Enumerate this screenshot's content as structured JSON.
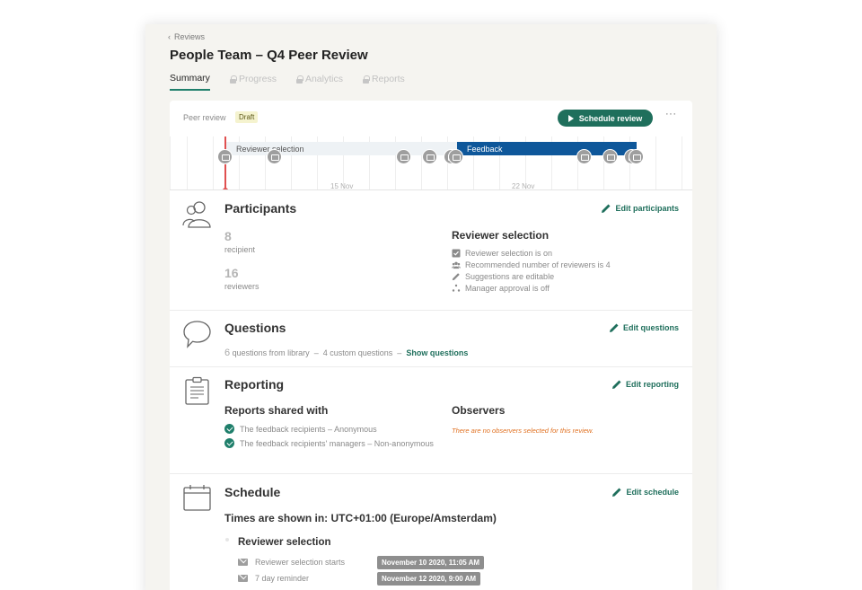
{
  "breadcrumb": {
    "label": "Reviews"
  },
  "page": {
    "title": "People Team – Q4 Peer Review"
  },
  "tabs": [
    {
      "label": "Summary",
      "active": true,
      "locked": false
    },
    {
      "label": "Progress",
      "active": false,
      "locked": true
    },
    {
      "label": "Analytics",
      "active": false,
      "locked": true
    },
    {
      "label": "Reports",
      "active": false,
      "locked": true
    }
  ],
  "header": {
    "type_label": "Peer review",
    "status_badge": "Draft",
    "schedule_button": "Schedule review",
    "more_label": "···"
  },
  "timeline": {
    "phases": [
      {
        "label": "Reviewer selection",
        "color": "#eef2f5"
      },
      {
        "label": "Feedback",
        "color": "#0e579a"
      }
    ],
    "tick_labels": [
      "15 Nov",
      "22 Nov"
    ],
    "today_color": "#e05050"
  },
  "participants": {
    "title": "Participants",
    "edit_label": "Edit participants",
    "recipients_count": "8",
    "recipients_label": "recipient",
    "reviewers_count": "16",
    "reviewers_label": "reviewers",
    "reviewer_selection": {
      "title": "Reviewer selection",
      "items": [
        {
          "icon": "checkbox-icon",
          "label": "Reviewer selection is on"
        },
        {
          "icon": "people-icon",
          "label": "Recommended number of reviewers is 4"
        },
        {
          "icon": "pencil-icon",
          "label": "Suggestions are editable"
        },
        {
          "icon": "dots-icon",
          "label": "Manager approval is off"
        }
      ]
    }
  },
  "questions": {
    "title": "Questions",
    "edit_label": "Edit questions",
    "library_count": "6",
    "library_label": "questions from library",
    "sep1": "–",
    "custom_label": "4 custom questions",
    "sep2": "–",
    "show_label": "Show questions"
  },
  "reporting": {
    "title": "Reporting",
    "edit_label": "Edit reporting",
    "shared_title": "Reports shared with",
    "shared_items": [
      "The feedback recipients – Anonymous",
      "The feedback recipients' managers – Non-anonymous"
    ],
    "observers_title": "Observers",
    "observers_empty": "There are no observers selected for this review."
  },
  "schedule": {
    "title": "Schedule",
    "edit_label": "Edit schedule",
    "timezone_line": "Times are shown in: UTC+01:00 (Europe/Amsterdam)",
    "phase_title": "Reviewer selection",
    "items": [
      {
        "label": "Reviewer selection starts",
        "date": "November 10 2020, 11:05 AM"
      },
      {
        "label": "7 day reminder",
        "date": "November 12 2020, 9:00 AM"
      }
    ]
  },
  "colors": {
    "accent": "#1f6f5c",
    "feedback_bar": "#0e579a",
    "warning": "#e07020"
  }
}
